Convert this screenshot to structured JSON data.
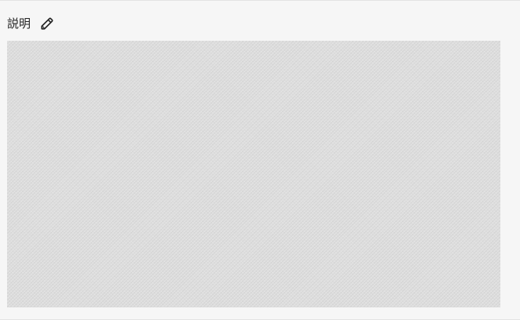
{
  "description_panel": {
    "title": "説明",
    "edit_icon": "pencil-icon"
  }
}
